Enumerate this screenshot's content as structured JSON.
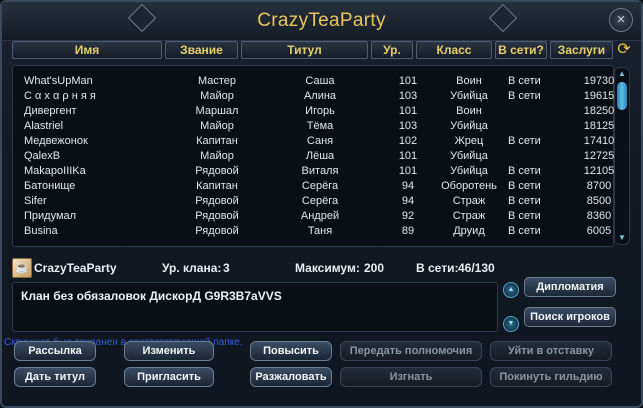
{
  "window": {
    "title": "CrazyTeaParty",
    "close_label": "×"
  },
  "columns": [
    "Имя",
    "Звание",
    "Титул",
    "Ур.",
    "Класс",
    "В сети?",
    "Заслуги"
  ],
  "members": [
    {
      "name": "What'sUpMan",
      "rank": "Мастер",
      "title": "Саша",
      "level": "101",
      "class": "Воин",
      "online": "В сети",
      "merit": "19730"
    },
    {
      "name": "С α х α ρ н я я",
      "rank": "Майор",
      "title": "Алина",
      "level": "103",
      "class": "Убийца",
      "online": "В сети",
      "merit": "19615"
    },
    {
      "name": "Дивергент",
      "rank": "Маршал",
      "title": "Игорь",
      "level": "101",
      "class": "Воин",
      "online": "",
      "merit": "18250"
    },
    {
      "name": "Alastriel",
      "rank": "Майор",
      "title": "Тёма",
      "level": "103",
      "class": "Убийца",
      "online": "",
      "merit": "18125"
    },
    {
      "name": "Медвежонок",
      "rank": "Капитан",
      "title": "Саня",
      "level": "102",
      "class": "Жрец",
      "online": "В сети",
      "merit": "17410"
    },
    {
      "name": "QalexB",
      "rank": "Майор",
      "title": "Лёша",
      "level": "101",
      "class": "Убийца",
      "online": "",
      "merit": "12725"
    },
    {
      "name": "MakapoIIIKa",
      "rank": "Рядовой",
      "title": "Виталя",
      "level": "101",
      "class": "Убийца",
      "online": "В сети",
      "merit": "12105"
    },
    {
      "name": "Батонище",
      "rank": "Капитан",
      "title": "Серёга",
      "level": "94",
      "class": "Оборотень",
      "online": "В сети",
      "merit": "8700"
    },
    {
      "name": "Sifer",
      "rank": "Рядовой",
      "title": "Серёга",
      "level": "94",
      "class": "Страж",
      "online": "В сети",
      "merit": "8500"
    },
    {
      "name": "Придумал",
      "rank": "Рядовой",
      "title": "Андрей",
      "level": "92",
      "class": "Страж",
      "online": "В сети",
      "merit": "8360"
    },
    {
      "name": "Busina",
      "rank": "Рядовой",
      "title": "Таня",
      "level": "89",
      "class": "Друид",
      "online": "В сети",
      "merit": "6005"
    }
  ],
  "info": {
    "guild_name": "CrazyTeaParty",
    "level_label": "Ур. клана:",
    "level_value": "3",
    "max_label": "Максимум:",
    "max_value": "200",
    "online_label": "В сети:",
    "online_value": "46/130"
  },
  "motd": "Клан без обязаловок ДискорД G9R3B7aVVS",
  "side_buttons": {
    "diplomacy": "Дипломатия",
    "search_players": "Поиск игроков"
  },
  "buttons": {
    "mailing": "Рассылка",
    "edit": "Изменить",
    "promote": "Повысить",
    "transfer": "Передать полномочия",
    "resign": "Уйти в отставку",
    "give_title": "Дать титул",
    "invite": "Пригласить",
    "demote": "Разжаловать",
    "kick": "Изгнать",
    "leave": "Покинуть гильдию"
  },
  "watermark": "Скриншот был сохранен в соответствующей папке.",
  "icons": {
    "refresh": "refresh-icon",
    "close": "close-icon",
    "guild": "guild-emblem-icon"
  },
  "colors": {
    "accent": "#e6cf6b",
    "text": "#e3e7ec",
    "scroll": "#5bc0ea"
  }
}
